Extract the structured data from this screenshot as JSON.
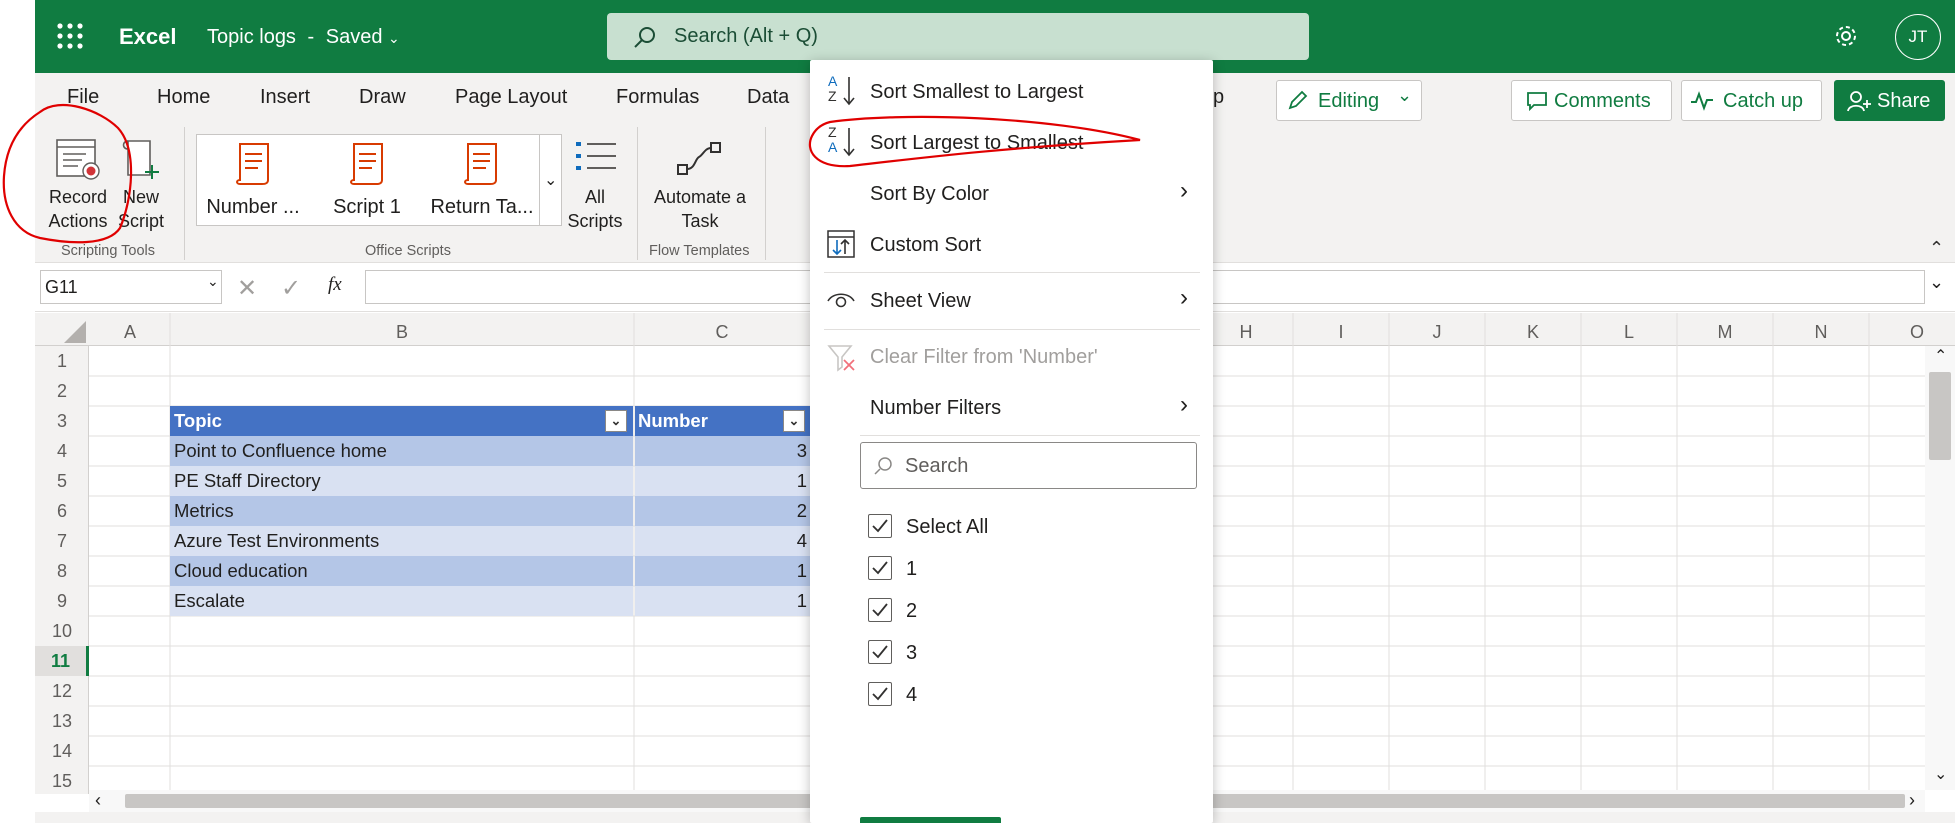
{
  "title_bar": {
    "app_name": "Excel",
    "doc_title": "Topic logs",
    "save_status": "Saved",
    "separator": "-",
    "search_placeholder": "Search (Alt + Q)",
    "avatar_initials": "JT"
  },
  "ribbon": {
    "tabs": [
      "File",
      "Home",
      "Insert",
      "Draw",
      "Page Layout",
      "Formulas",
      "Data",
      "p"
    ],
    "editing_label": "Editing",
    "comments_label": "Comments",
    "catchup_label": "Catch up",
    "share_label": "Share",
    "record_actions_label": [
      "Record",
      "Actions"
    ],
    "new_script_label": [
      "New",
      "Script"
    ],
    "scripts": [
      "Number ...",
      "Script 1",
      "Return Ta..."
    ],
    "all_scripts_label": [
      "All",
      "Scripts"
    ],
    "automate_label": [
      "Automate a",
      "Task"
    ],
    "group_scripting_tools": "Scripting Tools",
    "group_office_scripts": "Office Scripts",
    "group_flow_templates": "Flow Templates"
  },
  "formula_bar": {
    "name_box": "G11",
    "fx": "fx",
    "formula": ""
  },
  "grid": {
    "columns": [
      "A",
      "B",
      "C",
      "H",
      "I",
      "J",
      "K",
      "L",
      "M",
      "N",
      "O"
    ],
    "rows": [
      "1",
      "2",
      "3",
      "4",
      "5",
      "6",
      "7",
      "8",
      "9",
      "10",
      "11",
      "12",
      "13",
      "14",
      "15"
    ],
    "active_row": "11",
    "table_headers": [
      "Topic",
      "Number"
    ],
    "table_rows": [
      {
        "topic": "Point to Confluence home",
        "number": "3"
      },
      {
        "topic": "PE Staff Directory",
        "number": "1"
      },
      {
        "topic": "Metrics",
        "number": "2"
      },
      {
        "topic": "Azure Test Environments",
        "number": "4"
      },
      {
        "topic": "Cloud education",
        "number": "1"
      },
      {
        "topic": "Escalate",
        "number": "1"
      }
    ]
  },
  "filter_menu": {
    "sort_asc": "Sort Smallest to Largest",
    "sort_desc": "Sort Largest to Smallest",
    "sort_color": "Sort By Color",
    "custom_sort": "Custom Sort",
    "sheet_view": "Sheet View",
    "clear_filter": "Clear Filter from 'Number'",
    "number_filters": "Number Filters",
    "search_placeholder": "Search",
    "values": [
      "Select All",
      "1",
      "2",
      "3",
      "4"
    ],
    "sort_asc_icon_letters": [
      "A",
      "Z"
    ],
    "sort_desc_icon_letters": [
      "Z",
      "A"
    ]
  },
  "colors": {
    "excel_green": "#107c41",
    "table_header": "#4472c4",
    "band_dark": "#b4c6e7",
    "band_light": "#d9e1f2",
    "annotation_red": "#e00000",
    "script_icon": "#d83b01"
  }
}
